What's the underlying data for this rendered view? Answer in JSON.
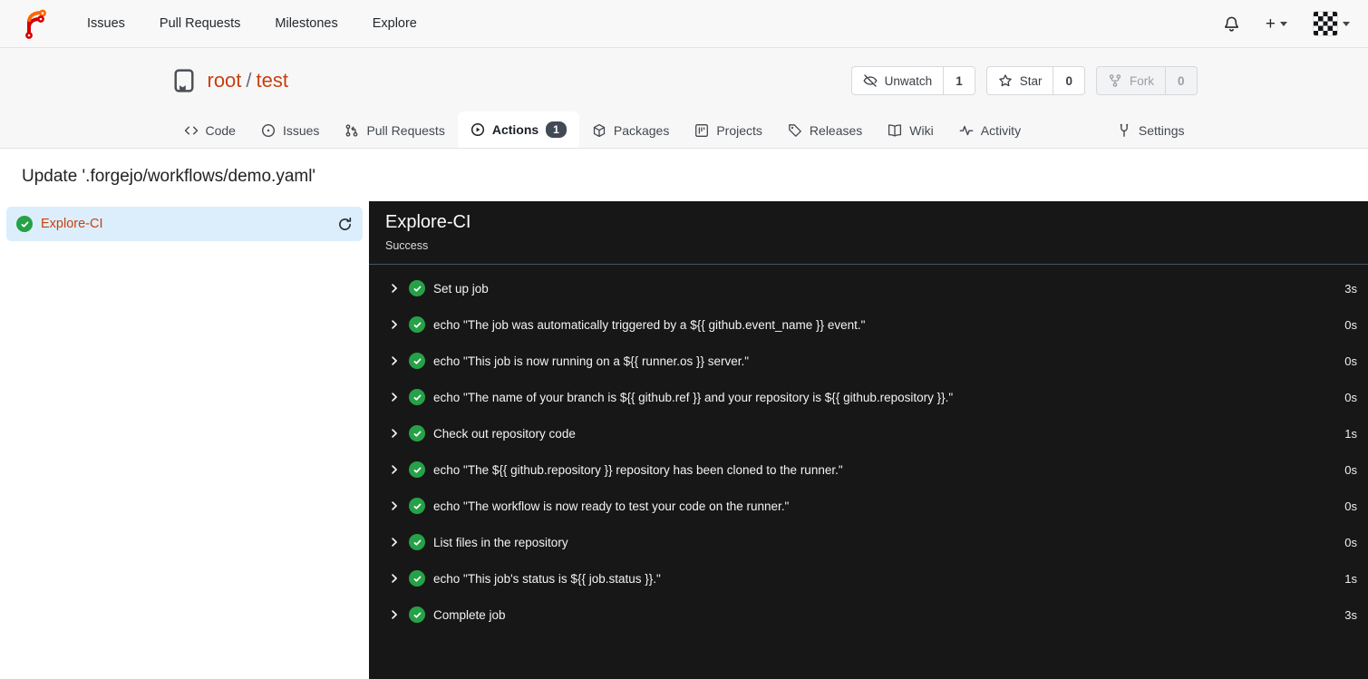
{
  "navbar": {
    "links": [
      "Issues",
      "Pull Requests",
      "Milestones",
      "Explore"
    ]
  },
  "repo_header": {
    "owner": "root",
    "separator": "/",
    "name": "test",
    "actions": [
      {
        "label": "Unwatch",
        "count": "1"
      },
      {
        "label": "Star",
        "count": "0"
      },
      {
        "label": "Fork",
        "count": "0",
        "disabled": true
      }
    ]
  },
  "tabs": [
    {
      "label": "Code"
    },
    {
      "label": "Issues"
    },
    {
      "label": "Pull Requests"
    },
    {
      "label": "Actions",
      "badge": "1",
      "active": true
    },
    {
      "label": "Packages"
    },
    {
      "label": "Projects"
    },
    {
      "label": "Releases"
    },
    {
      "label": "Wiki"
    },
    {
      "label": "Activity"
    },
    {
      "label": "Settings"
    }
  ],
  "page": {
    "title": "Update '.forgejo/workflows/demo.yaml'"
  },
  "sidebar": {
    "jobs": [
      {
        "name": "Explore-CI",
        "status": "success"
      }
    ]
  },
  "run_panel": {
    "title": "Explore-CI",
    "status": "Success",
    "steps": [
      {
        "name": "Set up job",
        "duration": "3s"
      },
      {
        "name": "echo \"The job was automatically triggered by a ${{ github.event_name }} event.\"",
        "duration": "0s"
      },
      {
        "name": "echo \"This job is now running on a ${{ runner.os }} server.\"",
        "duration": "0s"
      },
      {
        "name": "echo \"The name of your branch is ${{ github.ref }} and your repository is ${{ github.repository }}.\"",
        "duration": "0s"
      },
      {
        "name": "Check out repository code",
        "duration": "1s"
      },
      {
        "name": "echo \"The ${{ github.repository }} repository has been cloned to the runner.\"",
        "duration": "0s"
      },
      {
        "name": "echo \"The workflow is now ready to test your code on the runner.\"",
        "duration": "0s"
      },
      {
        "name": "List files in the repository",
        "duration": "0s"
      },
      {
        "name": "echo \"This job's status is ${{ job.status }}.\"",
        "duration": "1s"
      },
      {
        "name": "Complete job",
        "duration": "3s"
      }
    ]
  },
  "icons": {
    "logo": "forgejo-logo",
    "bell": "notifications",
    "plus": "+",
    "avatar": "identicon",
    "repo": "book-bookmark",
    "unwatch": "eye-slash",
    "star": "star-outline",
    "fork": "git-fork",
    "refresh": "sync-arrows",
    "step-status": "check-circle-green",
    "step-expand": "chevron-right"
  },
  "colors": {
    "accent_link": "#c8400f",
    "success_green": "#26a148",
    "panel_bg": "#171717",
    "panel_border": "#4a5462",
    "selected_job_bg": "#dceefb",
    "badge_bg": "#414a55",
    "header_bg": "#f7f7f8"
  }
}
